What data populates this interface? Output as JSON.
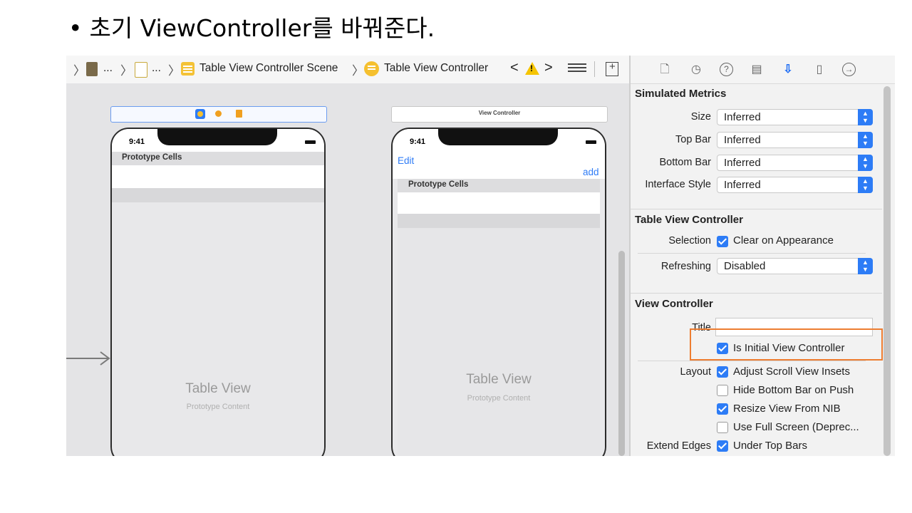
{
  "slide": {
    "bullet_marker": "•",
    "bullet_text": "초기 ViewController를 바꿔준다."
  },
  "jump_bar": {
    "ellipsis_1": "...",
    "ellipsis_2": "...",
    "scene_label": "Table View Controller Scene",
    "controller_label": "Table View Controller",
    "back_glyph": "<",
    "forward_glyph": ">",
    "separator_glyph": "〉",
    "warning_glyph": "!"
  },
  "canvas": {
    "left_phone": {
      "time": "9:41",
      "prototype_header": "Prototype Cells",
      "table_title": "Table View",
      "table_subtitle": "Prototype Content"
    },
    "right_scene_title": "View Controller",
    "right_phone": {
      "time": "9:41",
      "edit_button": "Edit",
      "add_button": "add",
      "prototype_header": "Prototype Cells",
      "table_title": "Table View",
      "table_subtitle": "Prototype Content"
    }
  },
  "inspector": {
    "tabs": [
      {
        "icon": "file-inspector-icon",
        "glyph": "🗋"
      },
      {
        "icon": "history-icon",
        "glyph": "◷"
      },
      {
        "icon": "help-icon",
        "glyph": "?"
      },
      {
        "icon": "identity-icon",
        "glyph": "▤"
      },
      {
        "icon": "attributes-icon",
        "glyph": "⇩"
      },
      {
        "icon": "size-icon",
        "glyph": "▯"
      },
      {
        "icon": "connections-icon",
        "glyph": "→"
      }
    ],
    "simulated_metrics": {
      "title": "Simulated Metrics",
      "size_label": "Size",
      "size_value": "Inferred",
      "top_bar_label": "Top Bar",
      "top_bar_value": "Inferred",
      "bottom_bar_label": "Bottom Bar",
      "bottom_bar_value": "Inferred",
      "interface_style_label": "Interface Style",
      "interface_style_value": "Inferred"
    },
    "table_view_controller": {
      "title": "Table View Controller",
      "selection_label": "Selection",
      "clear_on_appearance": "Clear on Appearance",
      "clear_on_appearance_checked": true,
      "refreshing_label": "Refreshing",
      "refreshing_value": "Disabled"
    },
    "view_controller": {
      "title": "View Controller",
      "title_label": "Title",
      "title_value": "",
      "is_initial": "Is Initial View Controller",
      "is_initial_checked": true,
      "layout_label": "Layout",
      "adjust_insets": "Adjust Scroll View Insets",
      "adjust_insets_checked": true,
      "hide_bottom_bar": "Hide Bottom Bar on Push",
      "hide_bottom_bar_checked": false,
      "resize_from_nib": "Resize View From NIB",
      "resize_from_nib_checked": true,
      "use_full_screen": "Use Full Screen (Deprec...",
      "use_full_screen_checked": false,
      "extend_edges_label": "Extend Edges",
      "under_top_bars": "Under Top Bars",
      "under_top_bars_checked": true
    }
  },
  "colors": {
    "accent_blue": "#2d7cf6",
    "highlight_orange": "#ed7d31",
    "scene_icon_yellow": "#f4c236"
  }
}
